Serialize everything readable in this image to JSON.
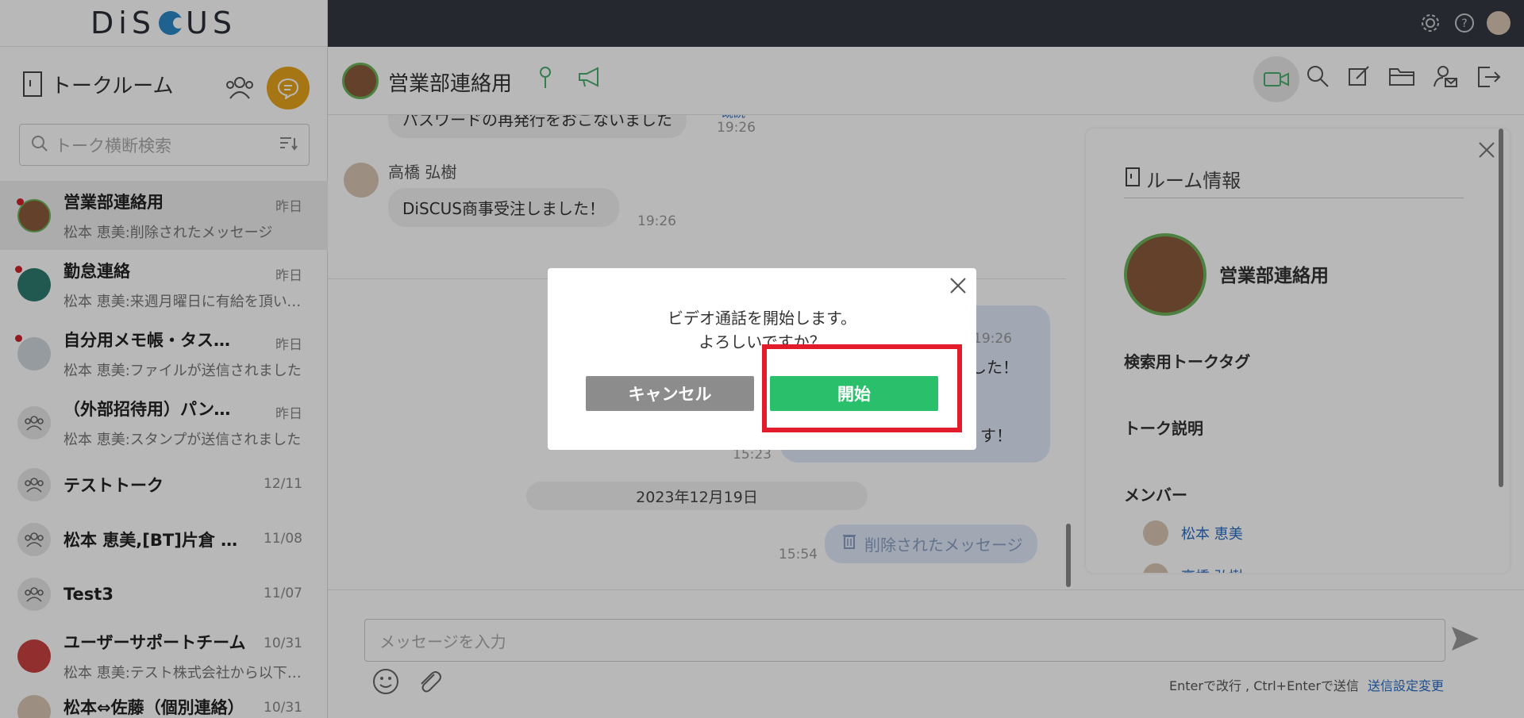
{
  "app": {
    "logo_text": "DiSCUS"
  },
  "sidebar": {
    "title": "トークルーム",
    "search_placeholder": "トーク横断検索",
    "rooms": [
      {
        "name": "営業部連絡用",
        "last": "松本 恵美:削除されたメッセージ",
        "date": "昨日",
        "unread": true,
        "active": true
      },
      {
        "name": "勤怠連絡",
        "last": "松本 恵美:来週月曜日に有給を頂いてもよろしいでしょうか",
        "date": "昨日",
        "unread": true
      },
      {
        "name": "自分用メモ帳・タスク管理",
        "last": "松本 恵美:ファイルが送信されました",
        "date": "昨日",
        "unread": true
      },
      {
        "name": "（外部招待用）パンフレット制作",
        "last": "松本 恵美:スタンプが送信されました",
        "date": "昨日"
      },
      {
        "name": "テストトーク",
        "last": "",
        "date": "12/11"
      },
      {
        "name": "松本 恵美,[BT]片倉 隆之",
        "last": "",
        "date": "11/08"
      },
      {
        "name": "Test3",
        "last": "",
        "date": "11/07"
      },
      {
        "name": "ユーザーサポートチーム",
        "last": "松本 恵美:テスト株式会社から以下の問い合わせ",
        "date": "10/31"
      },
      {
        "name": "松本⇔佐藤（個別連絡）",
        "last": "",
        "date": "10/31"
      }
    ]
  },
  "chat": {
    "room_name": "営業部連絡用",
    "messages": {
      "m1_text": "パスワードの再発行をおこないました",
      "m1_read": "既読",
      "m1_time": "19:26",
      "m2_sender": "高橋 弘樹",
      "m2_text": "DiSCUS商事受注しました！",
      "m2_time": "19:26",
      "m3_time": "19:26",
      "m3_text_a": "した！",
      "m3_text_b": "す！",
      "m3_side_time": "15:23",
      "date_separator": "2023年12月19日",
      "m4_text": "削除されたメッセージ",
      "m4_time": "15:54"
    }
  },
  "room_info": {
    "title": "ルーム情報",
    "room_name": "営業部連絡用",
    "tag_label": "検索用トークタグ",
    "desc_label": "トーク説明",
    "members_label": "メンバー",
    "members": [
      "松本 恵美",
      "高橋 弘樹"
    ]
  },
  "input": {
    "placeholder": "メッセージを入力",
    "hint": "Enterで改行 , Ctrl+Enterで送信",
    "setting_link": "送信設定変更"
  },
  "modal": {
    "line1": "ビデオ通話を開始します。",
    "line2": "よろしいですか？",
    "cancel_label": "キャンセル",
    "start_label": "開始"
  },
  "colors": {
    "topbar": "#343841",
    "accent_green": "#2ac06b",
    "highlight_red": "#e21c2a",
    "new_talk_orange": "#e6a21c",
    "unread_dot": "#d0202a"
  }
}
